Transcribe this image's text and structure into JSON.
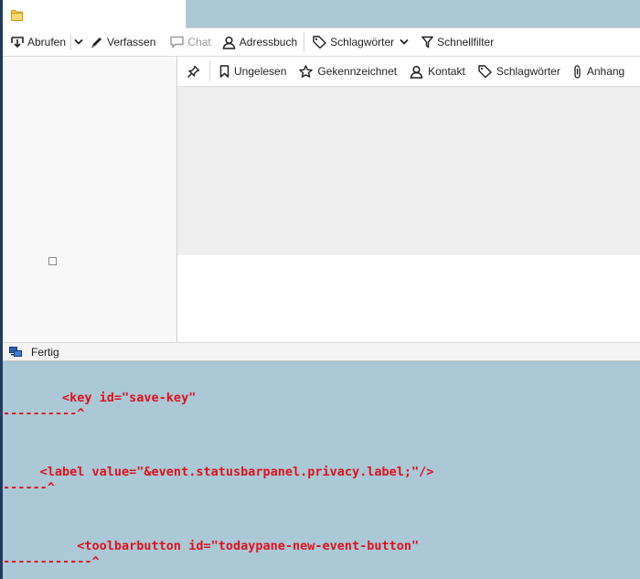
{
  "toolbar": {
    "get_mail": "Abrufen",
    "write": "Verfassen",
    "chat": "Chat",
    "address_book": "Adressbuch",
    "tags": "Schlagwörter",
    "quick_filter": "Schnellfilter"
  },
  "filter_bar": {
    "unread": "Ungelesen",
    "starred": "Gekennzeichnet",
    "contact": "Kontakt",
    "tags": "Schlagwörter",
    "attachment": "Anhang"
  },
  "status": {
    "text": "Fertig"
  },
  "errors": [
    {
      "code": "        <key id=\"save-key\"",
      "caret": "----------^"
    },
    {
      "code": "     <label value=\"&event.statusbarpanel.privacy.label;\"/>",
      "caret": "------^"
    },
    {
      "code": "          <toolbarbutton id=\"todaypane-new-event-button\"",
      "caret": "------------^"
    }
  ],
  "colors": {
    "background": "#aac8d6",
    "error_text": "#e0101c",
    "toolbar": "#ffffff"
  }
}
